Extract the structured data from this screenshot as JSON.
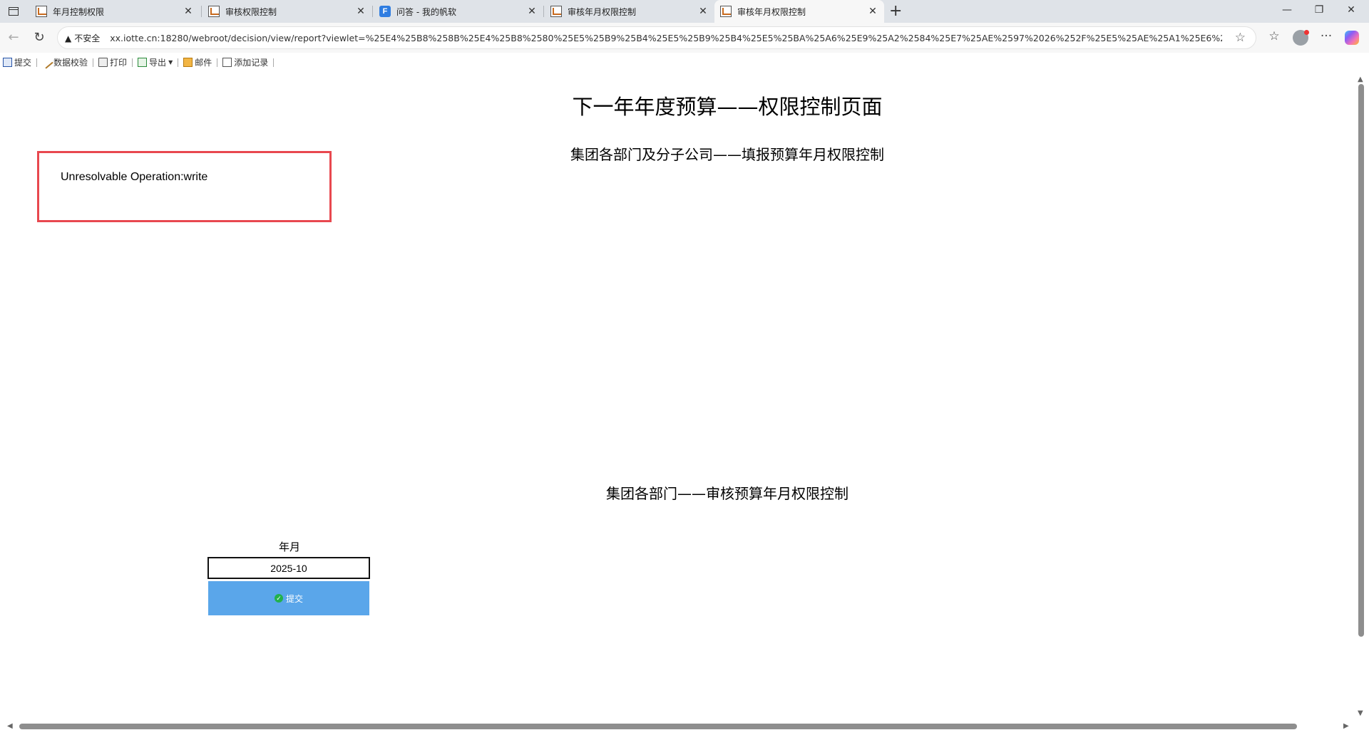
{
  "browser": {
    "tabs": [
      {
        "title": "年月控制权限",
        "favicon": "report-icon",
        "active": false
      },
      {
        "title": "审核权限控制",
        "favicon": "report-icon",
        "active": false
      },
      {
        "title": "问答 - 我的帆软",
        "favicon": "fanruan-icon",
        "active": false
      },
      {
        "title": "审核年月权限控制",
        "favicon": "report-icon",
        "active": false
      },
      {
        "title": "审核年月权限控制",
        "favicon": "report-icon",
        "active": true
      }
    ],
    "security_label": "不安全",
    "url": "xx.iotte.cn:18280/webroot/decision/view/report?viewlet=%25E4%25B8%258B%25E4%25B8%2580%25E5%25B9%25B4%25E5%25B9%25B4%25E5%25BA%25A6%25E9%25A2%2584%25E7%25AE%2597%2026%252F%25E5%25AE%25A1%25E6%25A0%25B8..."
  },
  "toolbar": {
    "submit": "提交",
    "validate": "数据校验",
    "print": "打印",
    "export": "导出",
    "mail": "邮件",
    "add_record": "添加记录"
  },
  "report": {
    "title": "下一年年度预算——权限控制页面",
    "subtitle_fill": "集团各部门及分子公司——填报预算年月权限控制",
    "subtitle_review": "集团各部门——审核预算年月权限控制",
    "error_message": "Unresolvable Operation:write",
    "year_month_label": "年月",
    "year_month_value": "2025-10",
    "submit_button": "提交"
  },
  "colors": {
    "error_border": "#e8484f",
    "submit_button_bg": "#5aa6ea",
    "tabstrip_bg": "#dfe3e8"
  }
}
